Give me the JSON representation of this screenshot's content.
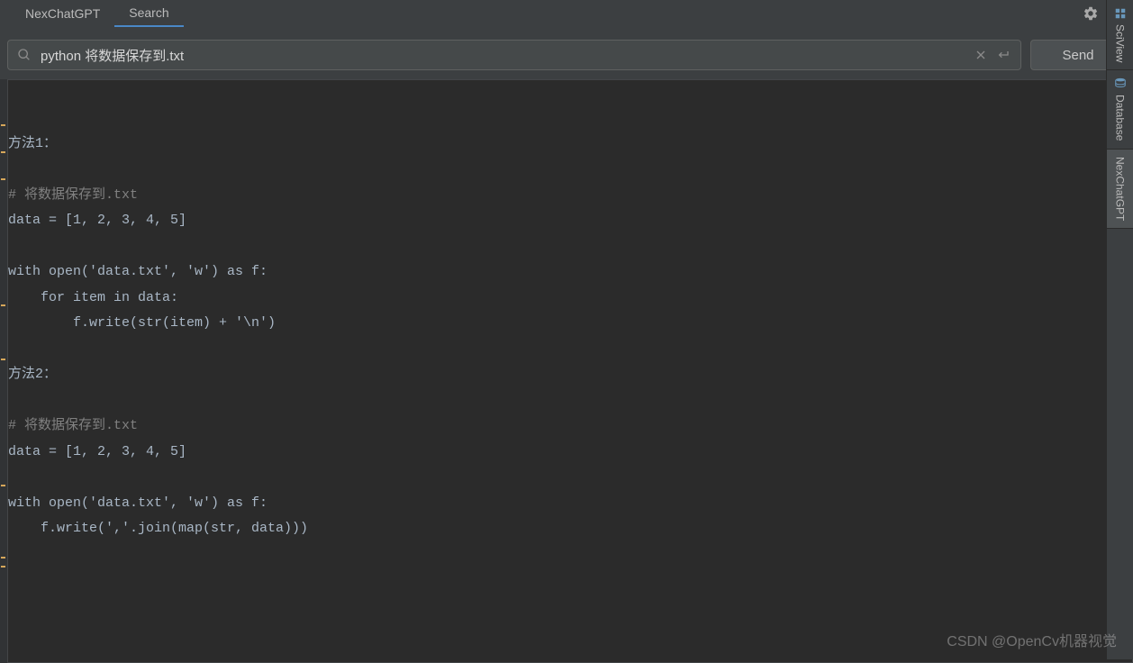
{
  "header": {
    "tabs": [
      {
        "label": "NexChatGPT"
      },
      {
        "label": "Search"
      }
    ]
  },
  "search": {
    "value": "python 将数据保存到.txt",
    "send_label": "Send"
  },
  "response": {
    "method1_label": "方法1：",
    "method1_comment": "# 将数据保存到.txt",
    "method1_line1": "data = [1, 2, 3, 4, 5]",
    "method1_line2": "with open('data.txt', 'w') as f:",
    "method1_line3": "    for item in data:",
    "method1_line4": "        f.write(str(item) + '\\n')",
    "method2_label": "方法2：",
    "method2_comment": "# 将数据保存到.txt",
    "method2_line1": "data = [1, 2, 3, 4, 5]",
    "method2_line2": "with open('data.txt', 'w') as f:",
    "method2_line3": "    f.write(','.join(map(str, data)))"
  },
  "sidebar": {
    "items": [
      {
        "label": "SciView"
      },
      {
        "label": "Database"
      },
      {
        "label": "NexChatGPT"
      }
    ]
  },
  "watermark": "CSDN @OpenCv机器视觉"
}
